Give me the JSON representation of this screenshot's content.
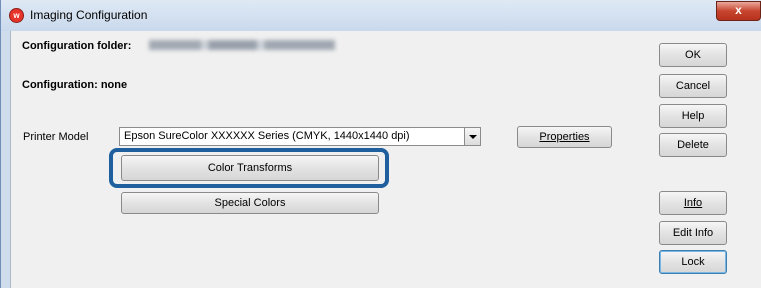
{
  "window": {
    "title": "Imaging Configuration",
    "close_label": "x"
  },
  "config": {
    "folder_label": "Configuration folder:",
    "configuration_label": "Configuration: none"
  },
  "printer": {
    "label": "Printer Model",
    "selected": "Epson  SureColor XXXXXX Series (CMYK, 1440x1440 dpi)"
  },
  "buttons": {
    "properties": "Properties",
    "color_transforms": "Color Transforms",
    "special_colors": "Special Colors",
    "ok": "OK",
    "cancel": "Cancel",
    "help": "Help",
    "delete": "Delete",
    "info": "Info",
    "edit_info": "Edit Info",
    "lock": "Lock"
  },
  "colors": {
    "highlight": "#1f5f9e",
    "client_bg": "#f0f0f0"
  }
}
